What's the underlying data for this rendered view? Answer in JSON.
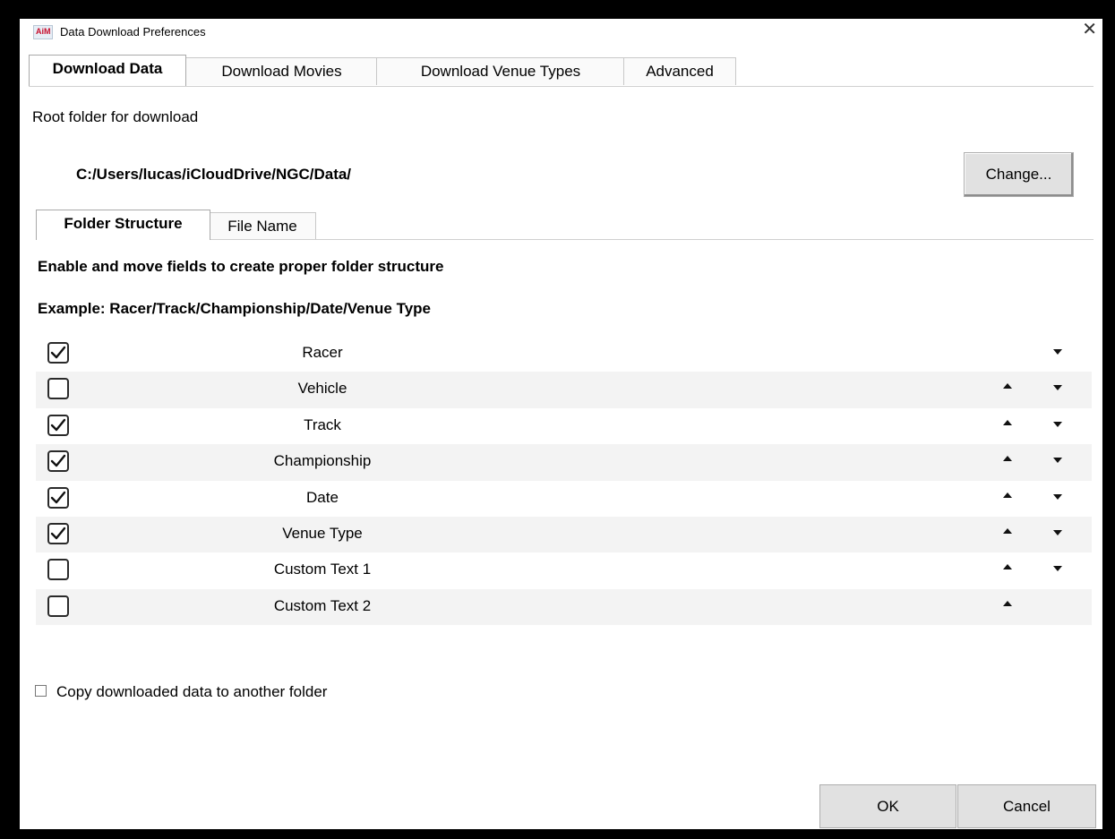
{
  "window": {
    "title": "Data Download Preferences",
    "close_glyph": "✕"
  },
  "main_tabs": [
    {
      "label": "Download Data",
      "active": true
    },
    {
      "label": "Download Movies",
      "active": false
    },
    {
      "label": "Download Venue Types",
      "active": false
    },
    {
      "label": "Advanced",
      "active": false
    }
  ],
  "root": {
    "label": "Root folder for download",
    "path": "C:/Users/lucas/iCloudDrive/NGC/Data/",
    "change_button": "Change..."
  },
  "sub_tabs": [
    {
      "label": "Folder Structure",
      "active": true
    },
    {
      "label": "File Name",
      "active": false
    }
  ],
  "instructions": {
    "line1": "Enable and move fields to create proper folder structure",
    "line2": "Example: Racer/Track/Championship/Date/Venue Type"
  },
  "fields": [
    {
      "label": "Racer",
      "checked": true,
      "up": false,
      "down": true
    },
    {
      "label": "Vehicle",
      "checked": false,
      "up": true,
      "down": true
    },
    {
      "label": "Track",
      "checked": true,
      "up": true,
      "down": true
    },
    {
      "label": "Championship",
      "checked": true,
      "up": true,
      "down": true
    },
    {
      "label": "Date",
      "checked": true,
      "up": true,
      "down": true
    },
    {
      "label": "Venue Type",
      "checked": true,
      "up": true,
      "down": true
    },
    {
      "label": "Custom Text 1",
      "checked": false,
      "up": true,
      "down": true
    },
    {
      "label": "Custom Text 2",
      "checked": false,
      "up": true,
      "down": false
    }
  ],
  "copy_option": {
    "label": "Copy downloaded data to another folder",
    "checked": false
  },
  "buttons": {
    "ok": "OK",
    "cancel": "Cancel"
  },
  "colors": {
    "stripe": "#f3f3f3",
    "button_face": "#e1e1e1",
    "frame": "#000000"
  }
}
